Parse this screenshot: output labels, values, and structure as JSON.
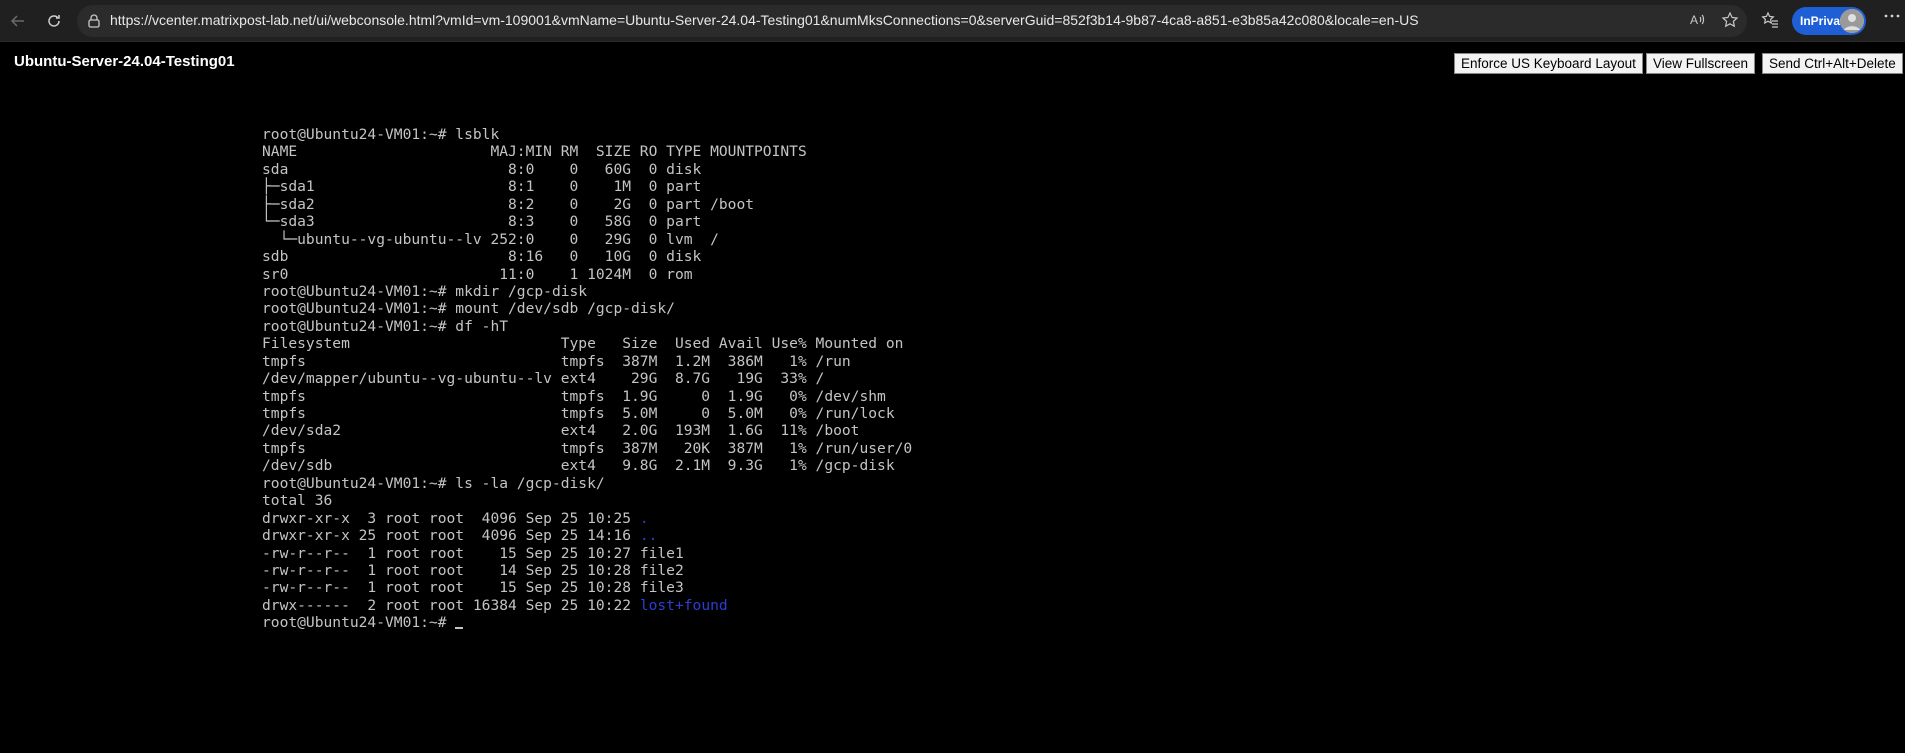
{
  "browser": {
    "url": "https://vcenter.matrixpost-lab.net/ui/webconsole.html?vmId=vm-109001&vmName=Ubuntu-Server-24.04-Testing01&numMksConnections=0&serverGuid=852f3b14-9b87-4ca8-a851-e3b85a42c080&locale=en-US",
    "inprivate_label": "InPrivate",
    "icons": [
      "back-icon",
      "refresh-icon",
      "lock-icon",
      "read-aloud-icon",
      "favorite-icon",
      "favorites-bar-icon",
      "more-icon"
    ]
  },
  "console": {
    "vm_title": "Ubuntu-Server-24.04-Testing01",
    "buttons": {
      "enforce_keyboard": "Enforce US Keyboard Layout",
      "fullscreen": "View Fullscreen",
      "ctrl_alt_del": "Send Ctrl+Alt+Delete"
    }
  },
  "terminal": {
    "lines": [
      "root@Ubuntu24-VM01:~# lsblk",
      "NAME                      MAJ:MIN RM  SIZE RO TYPE MOUNTPOINTS",
      "sda                         8:0    0   60G  0 disk",
      "├─sda1                      8:1    0    1M  0 part",
      "├─sda2                      8:2    0    2G  0 part /boot",
      "└─sda3                      8:3    0   58G  0 part",
      "  └─ubuntu--vg-ubuntu--lv 252:0    0   29G  0 lvm  /",
      "sdb                         8:16   0   10G  0 disk",
      "sr0                        11:0    1 1024M  0 rom",
      "root@Ubuntu24-VM01:~# mkdir /gcp-disk",
      "root@Ubuntu24-VM01:~# mount /dev/sdb /gcp-disk/",
      "root@Ubuntu24-VM01:~# df -hT",
      "Filesystem                        Type   Size  Used Avail Use% Mounted on",
      "tmpfs                             tmpfs  387M  1.2M  386M   1% /run",
      "/dev/mapper/ubuntu--vg-ubuntu--lv ext4    29G  8.7G   19G  33% /",
      "tmpfs                             tmpfs  1.9G     0  1.9G   0% /dev/shm",
      "tmpfs                             tmpfs  5.0M     0  5.0M   0% /run/lock",
      "/dev/sda2                         ext4   2.0G  193M  1.6G  11% /boot",
      "tmpfs                             tmpfs  387M   20K  387M   1% /run/user/0",
      "/dev/sdb                          ext4   9.8G  2.1M  9.3G   1% /gcp-disk",
      "root@Ubuntu24-VM01:~# ls -la /gcp-disk/",
      "total 36"
    ],
    "ls_entries": [
      {
        "meta": "drwxr-xr-x  3 root root  4096 Sep 25 10:25 ",
        "name": ".",
        "is_dir": true
      },
      {
        "meta": "drwxr-xr-x 25 root root  4096 Sep 25 14:16 ",
        "name": "..",
        "is_dir": true
      },
      {
        "meta": "-rw-r--r--  1 root root    15 Sep 25 10:27 ",
        "name": "file1",
        "is_dir": false
      },
      {
        "meta": "-rw-r--r--  1 root root    14 Sep 25 10:28 ",
        "name": "file2",
        "is_dir": false
      },
      {
        "meta": "-rw-r--r--  1 root root    15 Sep 25 10:28 ",
        "name": "file3",
        "is_dir": false
      },
      {
        "meta": "drwx------  2 root root 16384 Sep 25 10:22 ",
        "name": "lost+found",
        "is_dir": true
      }
    ],
    "prompt": "root@Ubuntu24-VM01:~# "
  }
}
